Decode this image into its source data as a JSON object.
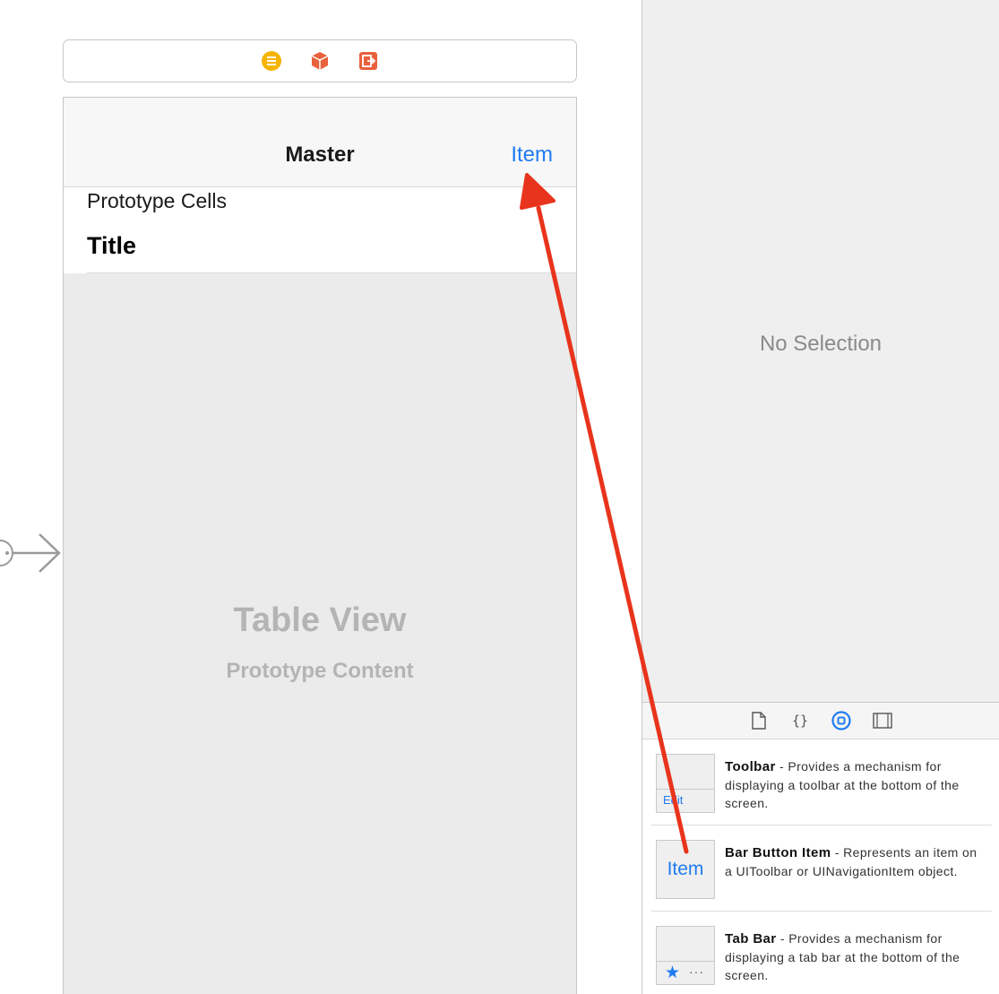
{
  "nav": {
    "title": "Master",
    "right_item": "Item"
  },
  "table": {
    "section_header": "Prototype Cells",
    "cell_title": "Title",
    "placeholder_title": "Table View",
    "placeholder_subtitle": "Prototype Content"
  },
  "inspector": {
    "empty_text": "No Selection"
  },
  "library": {
    "tabs": [
      "file-template-icon",
      "code-snippet-icon",
      "object-library-icon",
      "media-library-icon"
    ],
    "items": [
      {
        "name": "Toolbar",
        "description": " - Provides a mechanism for displaying a toolbar at the bottom of the screen.",
        "thumb_label": "Edit"
      },
      {
        "name": "Bar Button Item",
        "description": " - Represents an item on a UIToolbar or UINavigationItem object.",
        "thumb_label": "Item"
      },
      {
        "name": "Tab Bar",
        "description": " - Provides a mechanism for displaying a tab bar at the bottom of the screen.",
        "thumb_label": "···"
      }
    ]
  },
  "colors": {
    "accent": "#1f7cf2",
    "drag_arrow": "#e8341c",
    "dock_yellow": "#f4b400",
    "dock_orange": "#e8603c"
  }
}
